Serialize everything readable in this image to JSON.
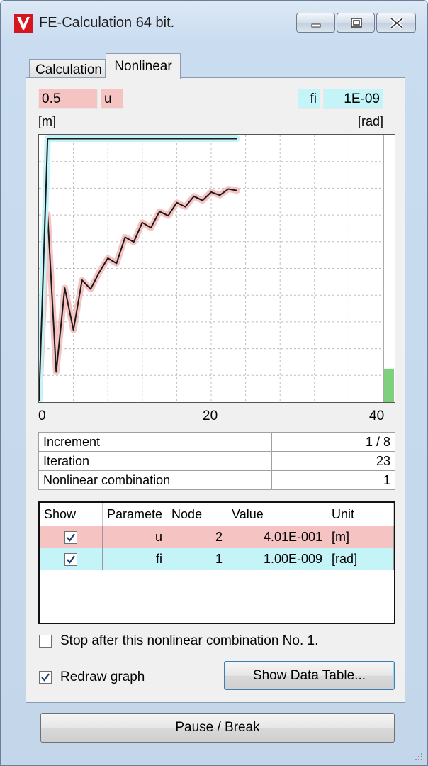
{
  "window": {
    "title": "FE-Calculation 64 bit."
  },
  "tabs": [
    {
      "label": "Calculation"
    },
    {
      "label": "Nonlinear"
    }
  ],
  "graph_header": {
    "left_value": "0.5",
    "left_param": "u",
    "left_unit": "[m]",
    "right_param": "fi",
    "right_value": "1E-09",
    "right_unit": "[rad]"
  },
  "colors": {
    "u_series": "#f6c3c3",
    "fi_series": "#c4f4f8",
    "progress": "#7ed07e"
  },
  "chart_data": {
    "type": "line",
    "xlim": [
      0,
      40
    ],
    "x_ticks": [
      "0",
      "20",
      "40"
    ],
    "left_ylim": [
      0,
      0.5
    ],
    "right_ylim": [
      0,
      1e-09
    ],
    "grid": true,
    "progress_fraction": 0.125,
    "series": [
      {
        "name": "u",
        "axis": "left",
        "x": [
          0,
          1,
          2,
          3,
          4,
          5,
          6,
          7,
          8,
          9,
          10,
          11,
          12,
          13,
          14,
          15,
          16,
          17,
          18,
          19,
          20,
          21,
          22,
          23
        ],
        "y": [
          0.0,
          0.355,
          0.055,
          0.215,
          0.135,
          0.23,
          0.213,
          0.245,
          0.272,
          0.262,
          0.312,
          0.303,
          0.34,
          0.33,
          0.361,
          0.353,
          0.378,
          0.37,
          0.39,
          0.382,
          0.398,
          0.392,
          0.404,
          0.401
        ]
      },
      {
        "name": "fi",
        "axis": "right",
        "x": [
          0,
          1,
          2,
          3,
          4,
          5,
          6,
          7,
          8,
          9,
          10,
          11,
          12,
          13,
          14,
          15,
          16,
          17,
          18,
          19,
          20,
          21,
          22,
          23
        ],
        "y": [
          0,
          1e-09,
          1e-09,
          1e-09,
          1e-09,
          1e-09,
          1e-09,
          1e-09,
          1e-09,
          1e-09,
          1e-09,
          1e-09,
          1e-09,
          1e-09,
          1e-09,
          1e-09,
          1e-09,
          1e-09,
          1e-09,
          1e-09,
          1e-09,
          1e-09,
          1e-09,
          1e-09
        ]
      }
    ]
  },
  "info": [
    {
      "label": "Increment",
      "value": "1 / 8"
    },
    {
      "label": "Iteration",
      "value": "23"
    },
    {
      "label": "Nonlinear combination",
      "value": "1"
    }
  ],
  "grid": {
    "headers": [
      "Show",
      "Paramete",
      "Node",
      "Value",
      "Unit"
    ],
    "rows": [
      {
        "show": true,
        "param": "u",
        "node": "2",
        "value": "4.01E-001",
        "unit": "[m]"
      },
      {
        "show": true,
        "param": "fi",
        "node": "1",
        "value": "1.00E-009",
        "unit": "[rad]"
      }
    ]
  },
  "options": {
    "stop_label": "Stop after this nonlinear combination No. 1.",
    "stop_checked": false,
    "redraw_label": "Redraw graph",
    "redraw_checked": true
  },
  "buttons": {
    "show_table": "Show Data Table...",
    "pause": "Pause / Break"
  }
}
